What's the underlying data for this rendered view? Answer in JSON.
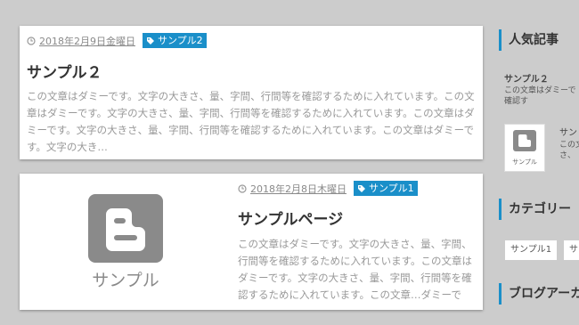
{
  "posts": [
    {
      "date": "2018年2月9日金曜日",
      "tag": "サンプル2",
      "title": "サンプル２",
      "excerpt": "この文章はダミーです。文字の大きさ、量、字間、行間等を確認するために入れています。この文章はダミーです。文字の大きさ、量、字間、行間等を確認するために入れています。この文章はダミーです。文字の大きさ、量、字間、行間等を確認するために入れています。この文章はダミーです。文字の大き…"
    },
    {
      "date": "2018年2月8日木曜日",
      "tag": "サンプル1",
      "title": "サンプルページ",
      "thumb_label": "サンプル",
      "excerpt": "この文章はダミーです。文字の大きさ、量、字間、行間等を確認するために入れています。この文章はダミーです。文字の大きさ、量、字間、行間等を確認するために入れています。この文章…ダミーです。文字の大きさ、量、字間、行間等を"
    }
  ],
  "sidebar": {
    "popular_heading": "人気記事",
    "popular": [
      {
        "title": "サンプル２",
        "text": "この文章はダミーで 間、行間等を確認す"
      },
      {
        "title": "サン",
        "text": "この文 きさ、",
        "thumb_label": "サンプル"
      }
    ],
    "category_heading": "カテゴリー",
    "categories": [
      "サンプル1",
      "サ"
    ],
    "archive_heading": "ブログアーカ"
  },
  "colors": {
    "accent": "#1a8fc9",
    "background": "#cccccc",
    "card": "#ffffff",
    "thumb_logo": "#8a8a8a"
  },
  "icons": [
    "clock-icon",
    "tag-icon",
    "blogger-logo-icon"
  ]
}
